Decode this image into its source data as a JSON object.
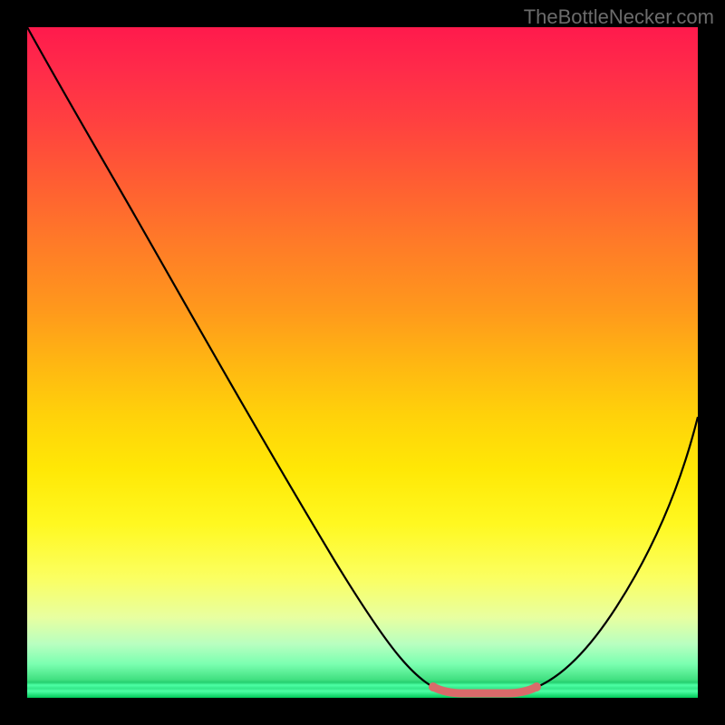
{
  "watermark": "TheBottleNecker.com",
  "chart_data": {
    "type": "line",
    "title": "",
    "xlabel": "",
    "ylabel": "",
    "xlim": [
      0,
      100
    ],
    "ylim": [
      0,
      100
    ],
    "series": [
      {
        "name": "bottleneck-curve",
        "x": [
          0,
          5,
          10,
          15,
          20,
          25,
          30,
          35,
          40,
          45,
          50,
          55,
          58,
          62,
          68,
          72,
          76,
          80,
          85,
          90,
          95,
          100
        ],
        "y": [
          100,
          91,
          82,
          73,
          64,
          56,
          48,
          40,
          32,
          25,
          18,
          11,
          6,
          2,
          0,
          0,
          1,
          4,
          10,
          19,
          30,
          42
        ]
      }
    ],
    "highlight_segment": {
      "name": "optimal-range",
      "x_start": 62,
      "x_end": 76,
      "color": "#d96a6a"
    },
    "background_gradient": {
      "stops": [
        {
          "pos": 0,
          "color": "#ff1a4c"
        },
        {
          "pos": 50,
          "color": "#ffb612"
        },
        {
          "pos": 85,
          "color": "#fdff70"
        },
        {
          "pos": 100,
          "color": "#00c858"
        }
      ]
    }
  }
}
